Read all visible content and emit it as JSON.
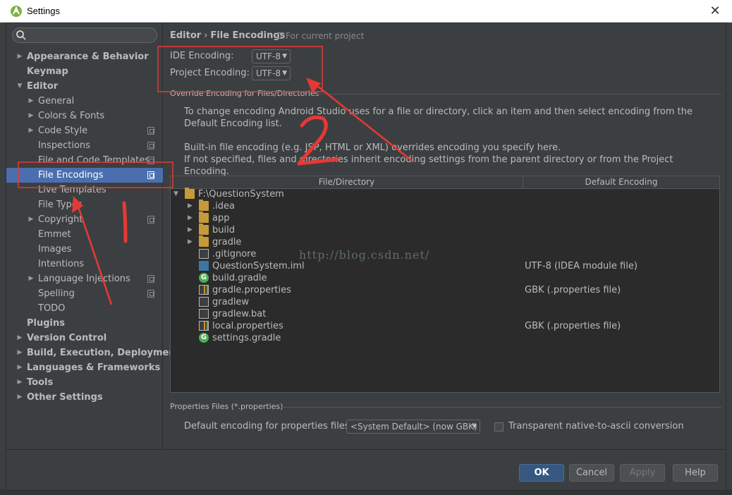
{
  "window": {
    "title": "Settings"
  },
  "sidebar": {
    "search_placeholder": "",
    "items": [
      {
        "label": "Appearance & Behavior",
        "bold": true,
        "expandable": true,
        "expanded": false,
        "level": 0,
        "copy": false
      },
      {
        "label": "Keymap",
        "bold": true,
        "expandable": false,
        "level": 0,
        "copy": false
      },
      {
        "label": "Editor",
        "bold": true,
        "expandable": true,
        "expanded": true,
        "level": 0,
        "copy": false
      },
      {
        "label": "General",
        "bold": false,
        "expandable": true,
        "expanded": false,
        "level": 1,
        "copy": false
      },
      {
        "label": "Colors & Fonts",
        "bold": false,
        "expandable": true,
        "expanded": false,
        "level": 1,
        "copy": false
      },
      {
        "label": "Code Style",
        "bold": false,
        "expandable": true,
        "expanded": false,
        "level": 1,
        "copy": true
      },
      {
        "label": "Inspections",
        "bold": false,
        "expandable": false,
        "level": 1,
        "copy": true
      },
      {
        "label": "File and Code Templates",
        "bold": false,
        "expandable": false,
        "level": 1,
        "copy": true
      },
      {
        "label": "File Encodings",
        "bold": false,
        "expandable": false,
        "level": 1,
        "copy": true,
        "selected": true
      },
      {
        "label": "Live Templates",
        "bold": false,
        "expandable": false,
        "level": 1,
        "copy": false
      },
      {
        "label": "File Types",
        "bold": false,
        "expandable": false,
        "level": 1,
        "copy": false
      },
      {
        "label": "Copyright",
        "bold": false,
        "expandable": true,
        "expanded": false,
        "level": 1,
        "copy": true
      },
      {
        "label": "Emmet",
        "bold": false,
        "expandable": false,
        "level": 1,
        "copy": false
      },
      {
        "label": "Images",
        "bold": false,
        "expandable": false,
        "level": 1,
        "copy": false
      },
      {
        "label": "Intentions",
        "bold": false,
        "expandable": false,
        "level": 1,
        "copy": false
      },
      {
        "label": "Language Injections",
        "bold": false,
        "expandable": true,
        "expanded": false,
        "level": 1,
        "copy": true
      },
      {
        "label": "Spelling",
        "bold": false,
        "expandable": false,
        "level": 1,
        "copy": true
      },
      {
        "label": "TODO",
        "bold": false,
        "expandable": false,
        "level": 1,
        "copy": false
      },
      {
        "label": "Plugins",
        "bold": true,
        "expandable": false,
        "level": 0,
        "copy": false
      },
      {
        "label": "Version Control",
        "bold": true,
        "expandable": true,
        "expanded": false,
        "level": 0,
        "copy": false
      },
      {
        "label": "Build, Execution, Deployment",
        "bold": true,
        "expandable": true,
        "expanded": false,
        "level": 0,
        "copy": false
      },
      {
        "label": "Languages & Frameworks",
        "bold": true,
        "expandable": true,
        "expanded": false,
        "level": 0,
        "copy": false
      },
      {
        "label": "Tools",
        "bold": true,
        "expandable": true,
        "expanded": false,
        "level": 0,
        "copy": false
      },
      {
        "label": "Other Settings",
        "bold": true,
        "expandable": true,
        "expanded": false,
        "level": 0,
        "copy": false
      }
    ]
  },
  "header": {
    "crumb_parent": "Editor",
    "crumb_sep": "›",
    "crumb_current": "File Encodings",
    "scope_text": "For current project"
  },
  "encoding": {
    "ide_label": "IDE Encoding:",
    "ide_value": "UTF-8",
    "project_label": "Project Encoding:",
    "project_value": "UTF-8"
  },
  "override": {
    "section_title": "Override Encoding for Files/Directories",
    "desc1": "To change encoding Android Studio uses for a file or directory, click an item and then select encoding from the Default Encoding list.",
    "desc2_line1": "Built-in file encoding (e.g. JSP, HTML or XML) overrides encoding you specify here.",
    "desc2_line2": "If not specified, files and directories inherit encoding settings from the parent directory or from the Project Encoding."
  },
  "table": {
    "col_file": "File/Directory",
    "col_encoding": "Default Encoding",
    "rows": [
      {
        "name": "F:\\QuestionSystem",
        "icon": "folder",
        "indent": 0,
        "arrow": "open",
        "encoding": ""
      },
      {
        "name": ".idea",
        "icon": "folder",
        "indent": 1,
        "arrow": "closed",
        "encoding": ""
      },
      {
        "name": "app",
        "icon": "folder",
        "indent": 1,
        "arrow": "closed",
        "encoding": ""
      },
      {
        "name": "build",
        "icon": "folder",
        "indent": 1,
        "arrow": "closed",
        "encoding": ""
      },
      {
        "name": "gradle",
        "icon": "folder",
        "indent": 1,
        "arrow": "closed",
        "encoding": ""
      },
      {
        "name": ".gitignore",
        "icon": "file",
        "indent": 1,
        "arrow": "none",
        "encoding": ""
      },
      {
        "name": "QuestionSystem.iml",
        "icon": "iml",
        "indent": 1,
        "arrow": "none",
        "encoding": "UTF-8 (IDEA module file)"
      },
      {
        "name": "build.gradle",
        "icon": "gradle",
        "indent": 1,
        "arrow": "none",
        "encoding": ""
      },
      {
        "name": "gradle.properties",
        "icon": "properties",
        "indent": 1,
        "arrow": "none",
        "encoding": "GBK (.properties file)"
      },
      {
        "name": "gradlew",
        "icon": "file",
        "indent": 1,
        "arrow": "none",
        "encoding": ""
      },
      {
        "name": "gradlew.bat",
        "icon": "file",
        "indent": 1,
        "arrow": "none",
        "encoding": ""
      },
      {
        "name": "local.properties",
        "icon": "properties",
        "indent": 1,
        "arrow": "none",
        "encoding": "GBK (.properties file)"
      },
      {
        "name": "settings.gradle",
        "icon": "gradle",
        "indent": 1,
        "arrow": "none",
        "encoding": ""
      }
    ]
  },
  "watermark": "http://blog.csdn.net/",
  "properties": {
    "section_title": "Properties Files (*.properties)",
    "default_label": "Default encoding for properties files:",
    "default_value": "<System Default> (now GBK)",
    "transparent_label": "Transparent native-to-ascii conversion",
    "transparent_checked": false
  },
  "buttons": {
    "ok": "OK",
    "cancel": "Cancel",
    "apply": "Apply",
    "help": "Help"
  },
  "annotations": {
    "mark1": "1",
    "mark2": "2",
    "color": "#e53935"
  },
  "colors": {
    "selection": "#4b6eaf",
    "primary_button": "#365880",
    "background": "#3c3f41"
  }
}
